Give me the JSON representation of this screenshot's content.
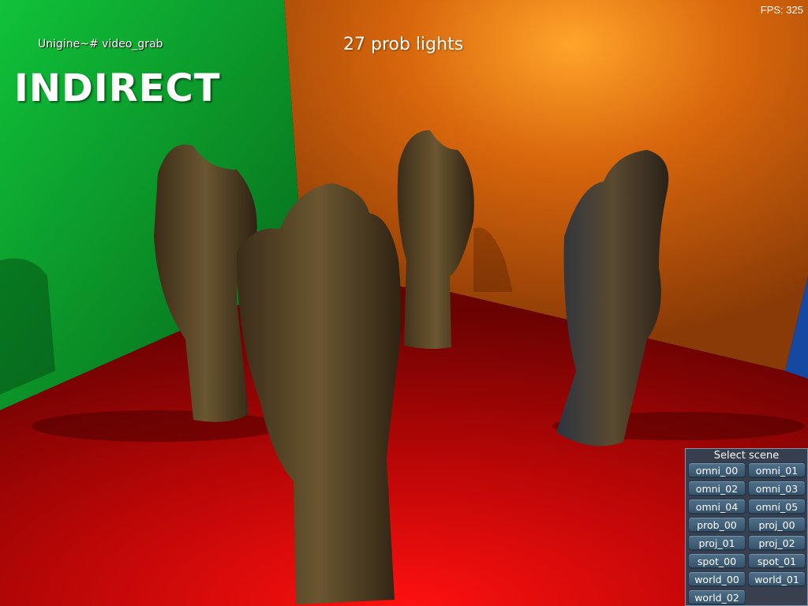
{
  "hud": {
    "console_text": "Unigine~# video_grab",
    "mode_label": "INDIRECT",
    "lights_caption": "27 prob lights",
    "fps_text": "FPS: 325"
  },
  "scene_selector": {
    "title": "Select scene",
    "buttons": [
      "omni_00",
      "omni_01",
      "omni_02",
      "omni_03",
      "omni_04",
      "omni_05",
      "prob_00",
      "proj_00",
      "proj_01",
      "proj_02",
      "spot_00",
      "spot_01",
      "world_00",
      "world_01",
      "world_02"
    ]
  },
  "colors": {
    "left_wall": "#0c9a2c",
    "back_wall": "#d8660c",
    "floor": "#c40808",
    "right_wall": "#1548a0",
    "statue": "#4a3b22"
  }
}
